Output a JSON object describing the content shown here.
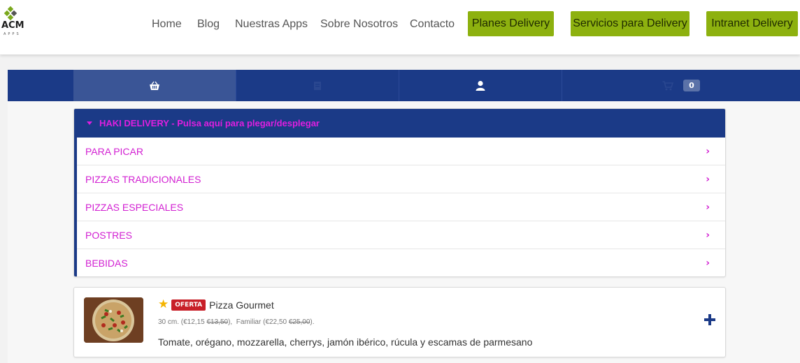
{
  "header": {
    "logo": {
      "text": "ACM",
      "sub": "APPS"
    },
    "nav": [
      "Home",
      "Blog",
      "Nuestras Apps",
      "Sobre Nosotros",
      "Contacto"
    ],
    "buttons": [
      "Planes Delivery",
      "Servicios para Delivery",
      "Intranet Delivery"
    ],
    "button_color": "#8db10f"
  },
  "tabs": {
    "items": [
      "basket-icon",
      "receipt-icon",
      "user-icon",
      "cart-icon"
    ],
    "cart_count": "0",
    "bar_color": "#1b3a87"
  },
  "menu": {
    "title": "HAKI DELIVERY - Pulsa aquí para plegar/desplegar",
    "categories": [
      "PARA PICAR",
      "PIZZAS TRADICIONALES",
      "PIZZAS ESPECIALES",
      "POSTRES",
      "BEBIDAS"
    ],
    "accent": "#d21fd2"
  },
  "product": {
    "name": "Pizza Gourmet",
    "badge": "OFERTA",
    "size1_label": "30 cm.",
    "size1_price": "€12,15",
    "size1_old": "€13,50",
    "size2_label": "Familiar",
    "size2_price": "€22,50",
    "size2_old": "€25,00",
    "description": "Tomate, orégano, mozzarella, cherrys, jamón ibérico, rúcula y escamas de parmesano",
    "icons": [
      "star-icon",
      "plus-icon"
    ]
  }
}
